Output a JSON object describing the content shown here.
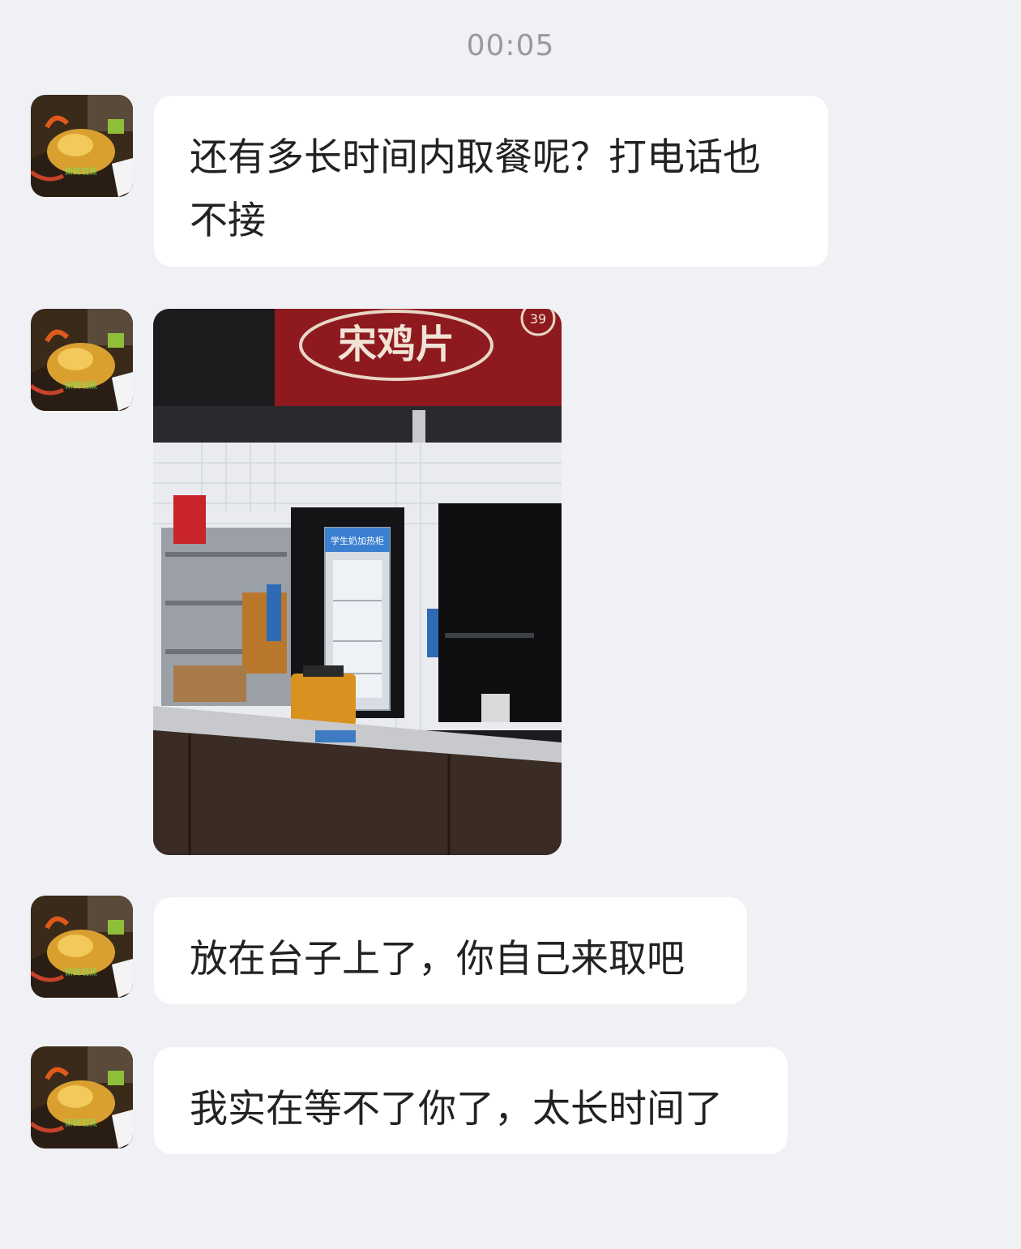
{
  "chat": {
    "timestamp": "00:05",
    "messages": [
      {
        "type": "text",
        "text": "还有多长时间内取餐呢？打电话也不接"
      },
      {
        "type": "image",
        "image": {
          "sign_text": "宋鸡片",
          "sign_badge": "39",
          "fridge_label": "学生奶加热柜",
          "content": "kitchen-counter-photo"
        }
      },
      {
        "type": "text",
        "text": "放在台子上了，你自己来取吧"
      },
      {
        "type": "text",
        "text": "我实在等不了你了，太长时间了"
      }
    ],
    "avatar": {
      "content": "roast-chicken-photo",
      "watermark": "新鲜现蒸"
    }
  },
  "colors": {
    "background": "#f0f1f5",
    "bubble": "#ffffff",
    "text": "#222222",
    "timestamp": "#9a9a9e",
    "sign_red": "#8e1a1f"
  }
}
